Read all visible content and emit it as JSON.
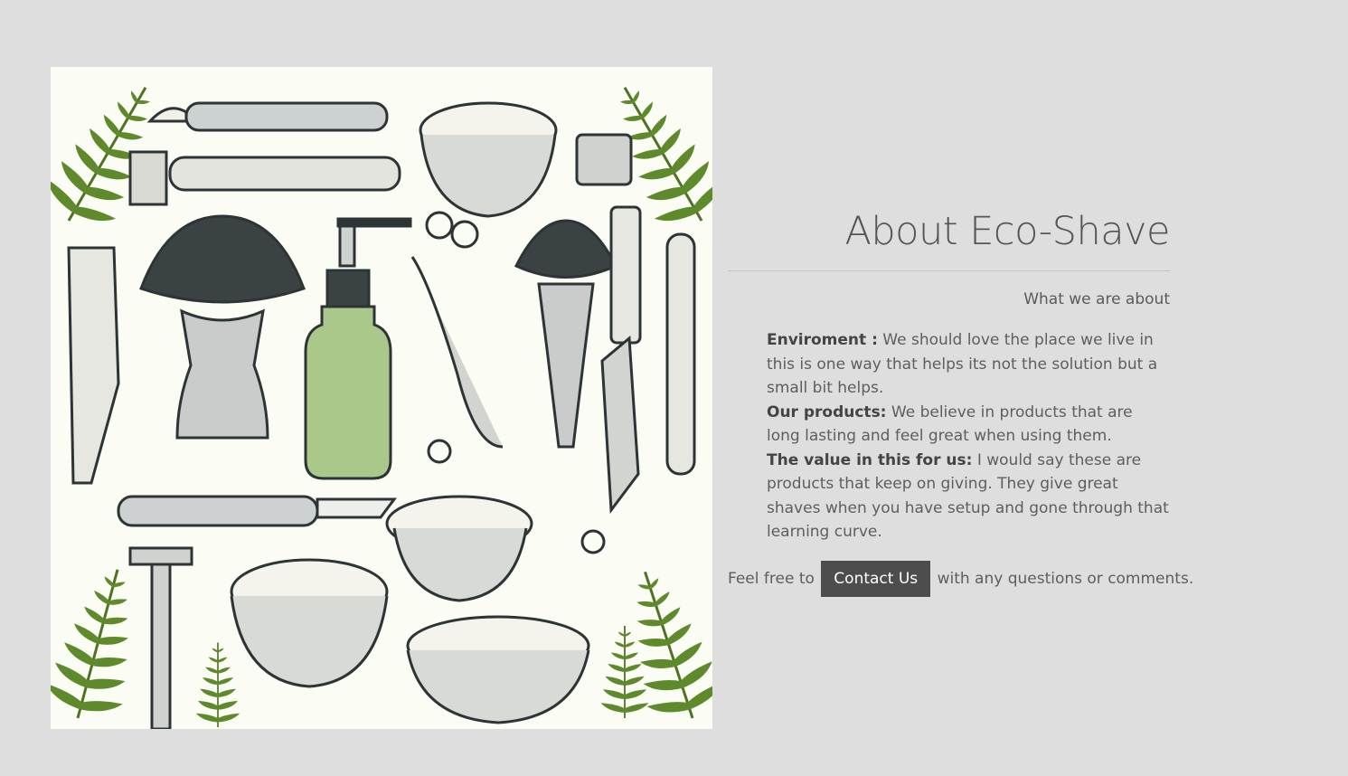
{
  "about": {
    "title": "About Eco-Shave",
    "subtitle": "What we are about",
    "points": [
      {
        "label": "Enviroment :",
        "text": " We should love the place we live in this is one way that helps its not the solution but a small bit helps."
      },
      {
        "label": "Our products:",
        "text": " We believe in products that are long lasting and feel great when using them."
      },
      {
        "label": "The value in this for us:",
        "text": " I would say these are products that keep on giving. They give great shaves when you have setup and gone through that learning curve."
      }
    ],
    "contact_prefix": "Feel free to",
    "contact_button": "Contact Us",
    "contact_suffix": "with any questions or comments."
  },
  "colors": {
    "background": "#dedede",
    "button": "#4d4d4d",
    "fern": "#5a7d2a"
  },
  "illustration": {
    "icons": [
      "fern-icon",
      "razor-icon",
      "shaving-brush-icon",
      "soap-bottle-icon",
      "shaving-bowl-icon",
      "comb-icon",
      "safety-razor-icon",
      "scissors-icon"
    ]
  }
}
